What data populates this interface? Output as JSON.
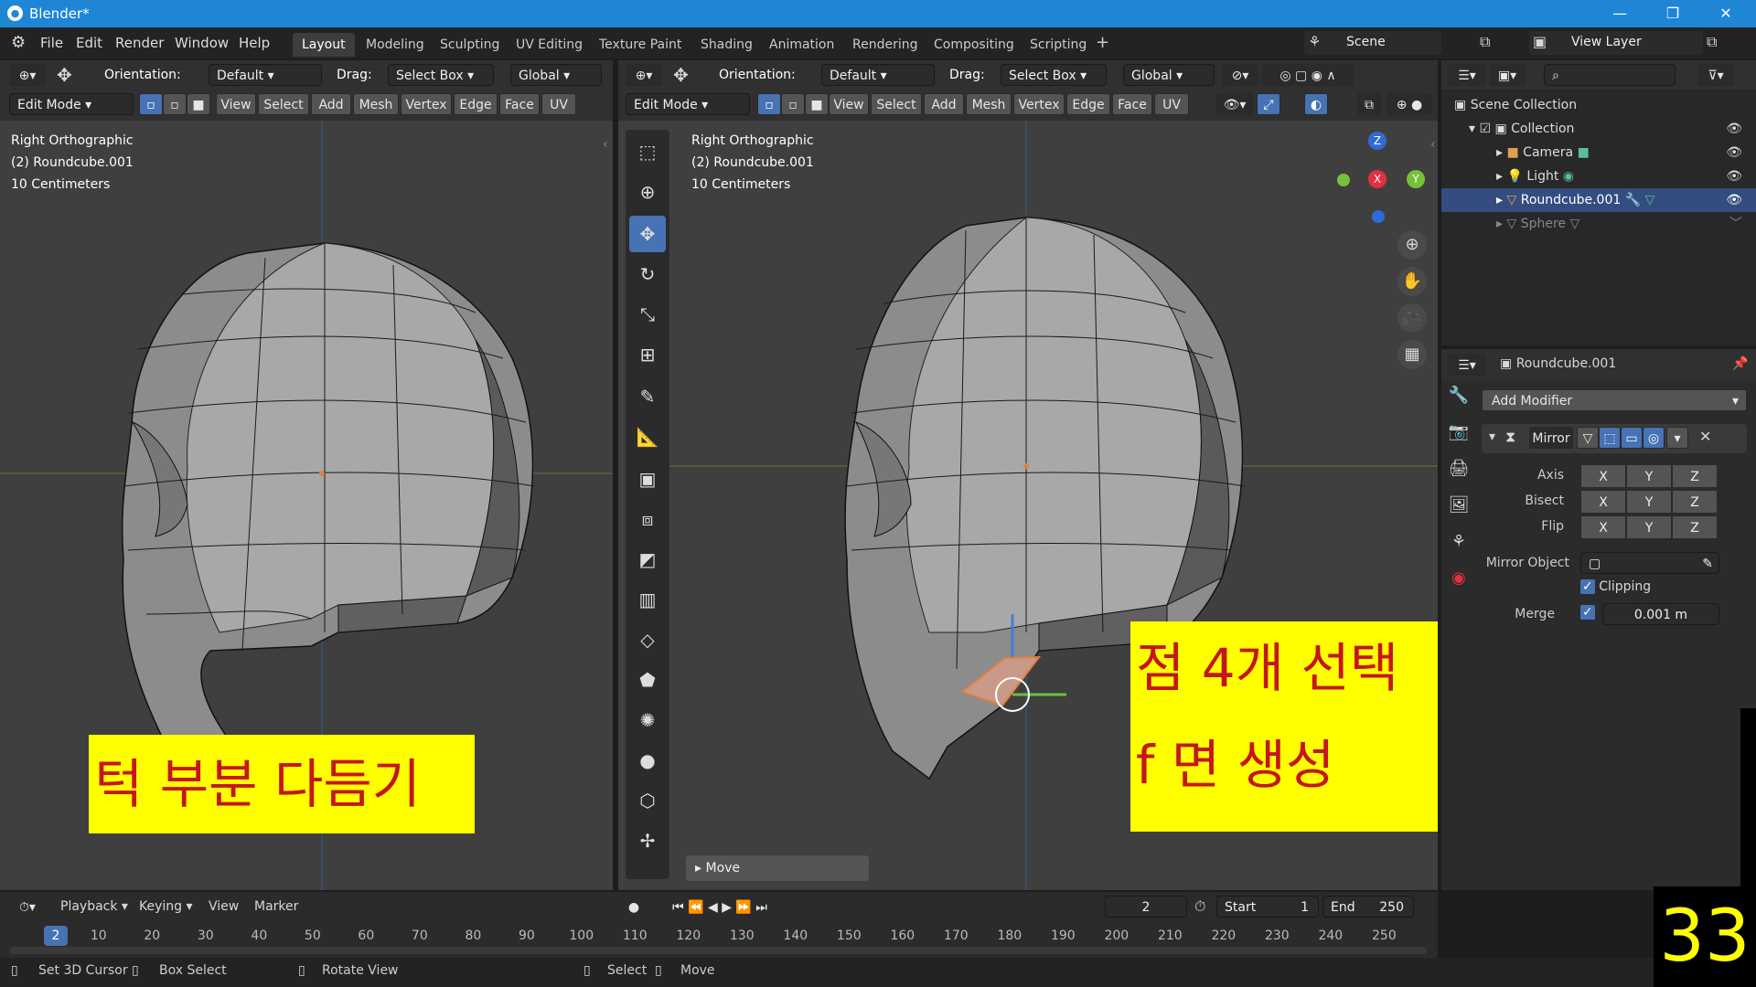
{
  "title": "Blender*",
  "menu": [
    "File",
    "Edit",
    "Render",
    "Window",
    "Help"
  ],
  "workspaces": [
    "Layout",
    "Modeling",
    "Sculpting",
    "UV Editing",
    "Texture Paint",
    "Shading",
    "Animation",
    "Rendering",
    "Compositing",
    "Scripting"
  ],
  "scene": "Scene",
  "view_layer": "View Layer",
  "vp_header": {
    "orientation_label": "Orientation:",
    "orientation": "Default",
    "drag_label": "Drag:",
    "drag": "Select Box",
    "transform": "Global",
    "mode": "Edit Mode",
    "menus": [
      "View",
      "Select",
      "Add",
      "Mesh",
      "Vertex",
      "Edge",
      "Face",
      "UV"
    ]
  },
  "vp_left": {
    "info": [
      "Right Orthographic",
      "(2) Roundcube.001",
      "10 Centimeters"
    ],
    "caption": "턱 부분 다듬기"
  },
  "vp_right": {
    "info": [
      "Right Orthographic",
      "(2) Roundcube.001",
      "10 Centimeters"
    ],
    "caption1": "점 4개 선택",
    "caption2": "f 면 생성",
    "last_op": "Move"
  },
  "gizmo": {
    "z": "Z",
    "x": "X",
    "y": "Y"
  },
  "outliner": {
    "root": "Scene Collection",
    "collection": "Collection",
    "items": [
      "Camera",
      "Light",
      "Roundcube.001",
      "Sphere"
    ]
  },
  "properties": {
    "object": "Roundcube.001",
    "add_modifier": "Add Modifier",
    "modifier": "Mirror",
    "axis_label": "Axis",
    "bisect_label": "Bisect",
    "flip_label": "Flip",
    "xyz": [
      "X",
      "Y",
      "Z"
    ],
    "mirror_object_label": "Mirror Object",
    "clipping": "Clipping",
    "merge_label": "Merge",
    "merge_value": "0.001 m"
  },
  "timeline": {
    "playback": "Playback",
    "keying": "Keying",
    "view": "View",
    "marker": "Marker",
    "frame": "2",
    "start_label": "Start",
    "start": "1",
    "end_label": "End",
    "end": "250",
    "ticks": [
      "2",
      "10",
      "20",
      "30",
      "40",
      "50",
      "60",
      "70",
      "80",
      "90",
      "100",
      "110",
      "120",
      "130",
      "140",
      "150",
      "160",
      "170",
      "180",
      "190",
      "200",
      "210",
      "220",
      "230",
      "240",
      "250"
    ]
  },
  "status": {
    "s1": "Set 3D Cursor",
    "s2": "Box Select",
    "s3": "Rotate View",
    "s4": "Select",
    "s5": "Move"
  },
  "badge": "33"
}
